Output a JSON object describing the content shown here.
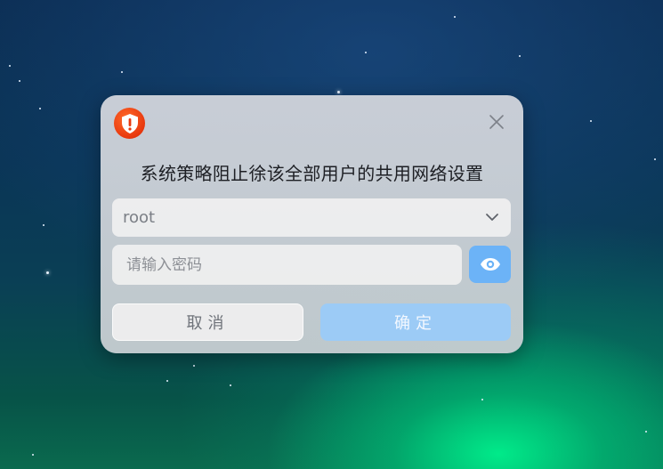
{
  "dialog": {
    "icon": "shield-warning-icon",
    "title": "系统策略阻止徐该全部用户的共用网络设置",
    "close_icon": "close-icon",
    "user_select": {
      "value": "root",
      "icon": "chevron-down-icon"
    },
    "password": {
      "placeholder": "请输入密码",
      "value": "",
      "toggle_icon": "eye-icon"
    },
    "buttons": {
      "cancel": "取消",
      "confirm": "确定"
    }
  },
  "colors": {
    "accent": "#6cb3f7",
    "confirm_disabled": "#9ccbf6",
    "warning": "#e8380e"
  }
}
